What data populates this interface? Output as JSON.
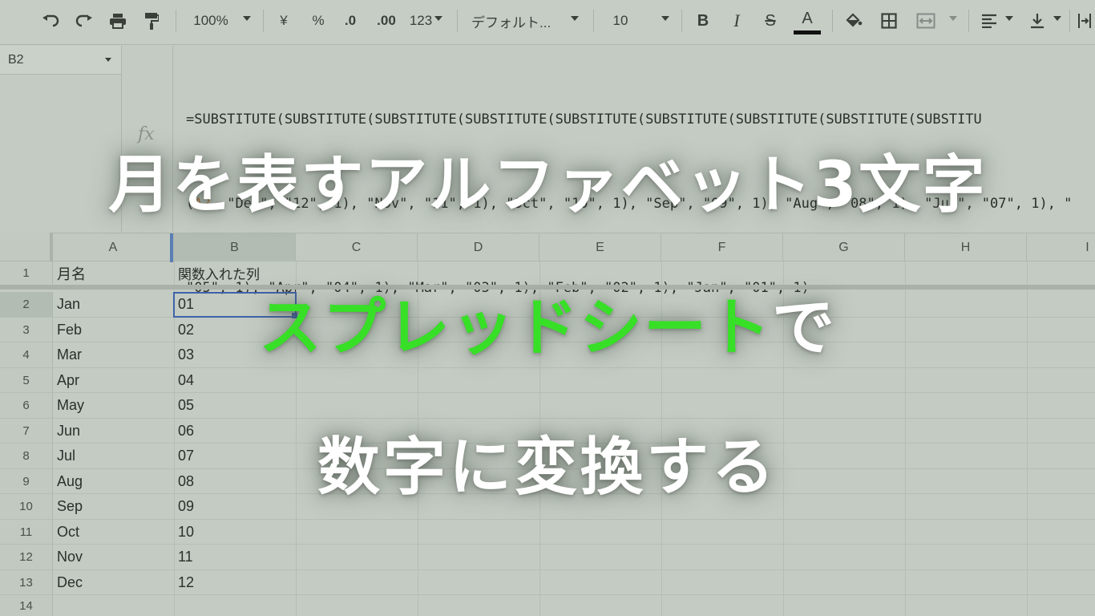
{
  "toolbar": {
    "zoom": "100%",
    "currency": "¥",
    "percent": "%",
    "decimal_decrease": ".0",
    "decimal_increase": ".00",
    "number_format": "123",
    "font": "デフォルト...",
    "font_size": "10",
    "bold": "B",
    "italic": "I",
    "strike": "S",
    "text_color": "A",
    "text_color_swatch": "#111111"
  },
  "formula_bar": {
    "cell_ref": "B2",
    "line1": "=SUBSTITUTE(SUBSTITUTE(SUBSTITUTE(SUBSTITUTE(SUBSTITUTE(SUBSTITUTE(SUBSTITUTE(SUBSTITUTE(SUBSTITU",
    "line2_ref": "A2",
    "line2_open": "(",
    "line2_rest": ", \"Dec\", \"12\", 1), \"Nov\", \"11\", 1), \"Oct\", \"10\", 1), \"Sep\", \"09\", 1), \"Aug\", \"08\", 1), \"Jul\", \"07\", 1), \"",
    "line3": "\"05\", 1), \"Apr\", \"04\", 1), \"Mar\", \"03\", 1), \"Feb\", \"02\", 1), \"Jan\", \"01\", 1)",
    "fx": "fx"
  },
  "columns": [
    "A",
    "B",
    "C",
    "D",
    "E",
    "F",
    "G",
    "H",
    "I"
  ],
  "rows": [
    {
      "num": "1",
      "a": "月名",
      "b": "関数入れた列"
    },
    {
      "num": "2",
      "a": "Jan",
      "b": "01"
    },
    {
      "num": "3",
      "a": "Feb",
      "b": "02"
    },
    {
      "num": "4",
      "a": "Mar",
      "b": "03"
    },
    {
      "num": "5",
      "a": "Apr",
      "b": "04"
    },
    {
      "num": "6",
      "a": "May",
      "b": "05"
    },
    {
      "num": "7",
      "a": "Jun",
      "b": "06"
    },
    {
      "num": "8",
      "a": "Jul",
      "b": "07"
    },
    {
      "num": "9",
      "a": "Aug",
      "b": "08"
    },
    {
      "num": "10",
      "a": "Sep",
      "b": "09"
    },
    {
      "num": "11",
      "a": "Oct",
      "b": "10"
    },
    {
      "num": "12",
      "a": "Nov",
      "b": "11"
    },
    {
      "num": "13",
      "a": "Dec",
      "b": "12"
    },
    {
      "num": "14",
      "a": "",
      "b": ""
    }
  ],
  "headline": {
    "line1": "月を表すアルファベット3文字",
    "line2_green": "スプレッドシート",
    "line2_white": "で",
    "line3": "数字に変換する",
    "accent_color": "#37e027"
  }
}
